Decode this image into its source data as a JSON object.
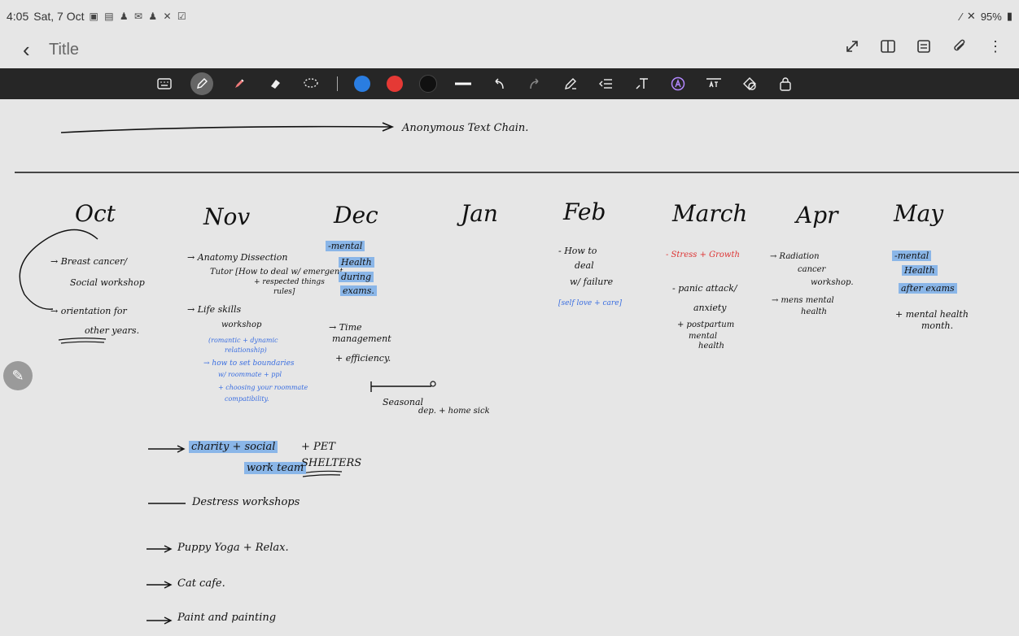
{
  "status": {
    "time": "4:05",
    "date": "Sat, 7 Oct",
    "battery": "95%",
    "icons": [
      "teams-icon",
      "gallery-icon",
      "person-icon",
      "mail-icon",
      "person-icon",
      "tools-icon",
      "check-icon"
    ]
  },
  "title": {
    "back_icon": "back-chevron-icon",
    "text": "Title"
  },
  "title_actions": [
    "expand-icon",
    "book-icon",
    "notes-icon",
    "attach-icon",
    "more-icon"
  ],
  "toolbar": {
    "tools": [
      "keyboard-icon",
      "pen-icon",
      "highlighter-icon",
      "eraser-icon",
      "lasso-icon"
    ],
    "colors": [
      "#2a7de1",
      "#e53935",
      "#111111"
    ],
    "actions": [
      "line-width-icon",
      "undo-icon",
      "redo-icon",
      "pen-settings-icon",
      "indent-icon",
      "text-icon",
      "style-icon",
      "text-box-icon",
      "shape-icon",
      "lock-icon"
    ]
  },
  "note": {
    "headline": "Anonymous Text Chain.",
    "months": [
      "Oct",
      "Nov",
      "Dec",
      "Jan",
      "Feb",
      "March",
      "Apr",
      "May"
    ],
    "oct": {
      "line1": "→ Breast cancer/",
      "line2": "Social workshop",
      "line3": "→ orientation for",
      "line4": "other years."
    },
    "nov": {
      "line1": "→ Anatomy Dissection",
      "line2": "Tutor [How to deal w/ emergent",
      "line3": "+ respected things",
      "line4": "rules]",
      "line5": "→ Life skills",
      "line6": "workshop",
      "blue1": "(romantic + dynamic",
      "blue2": "relationship)",
      "blue3": "→ how to set boundaries",
      "blue4": "w/ roommate + ppl",
      "blue5": "+ choosing your roommate",
      "blue6": "compatibility."
    },
    "dec": {
      "hl1": "-mental",
      "hl2": "Health",
      "hl3": "during",
      "hl4": "exams.",
      "line1": "→ Time",
      "line2": "management",
      "line3": "+ efficiency."
    },
    "seasonal": {
      "line1": "Seasonal",
      "line2": "dep. + home sick"
    },
    "feb": {
      "line1": "- How to",
      "line2": "deal",
      "line3": "w/ failure",
      "blue1": "[self love + care]"
    },
    "march": {
      "red1": "- Stress + Growth",
      "line1": "- panic attack/",
      "line2": "anxiety",
      "line3": "+ postpartum",
      "line4": "mental",
      "line5": "health"
    },
    "apr": {
      "line1": "→ Radiation",
      "line2": "cancer",
      "line3": "workshop.",
      "line4": "→ mens mental",
      "line5": "health"
    },
    "may": {
      "hl1": "-mental",
      "hl2": "Health",
      "hl3": "after exams",
      "line1": "+ mental health",
      "line2": "month."
    },
    "bottom": {
      "charity_hl": "charity + social",
      "work_hl": "work team",
      "pet": "+ PET",
      "shelters": "SHELTERS",
      "item2": "Destress workshops",
      "item3": "Puppy Yoga + Relax.",
      "item4": "Cat cafe.",
      "item5": "Paint and painting"
    }
  }
}
